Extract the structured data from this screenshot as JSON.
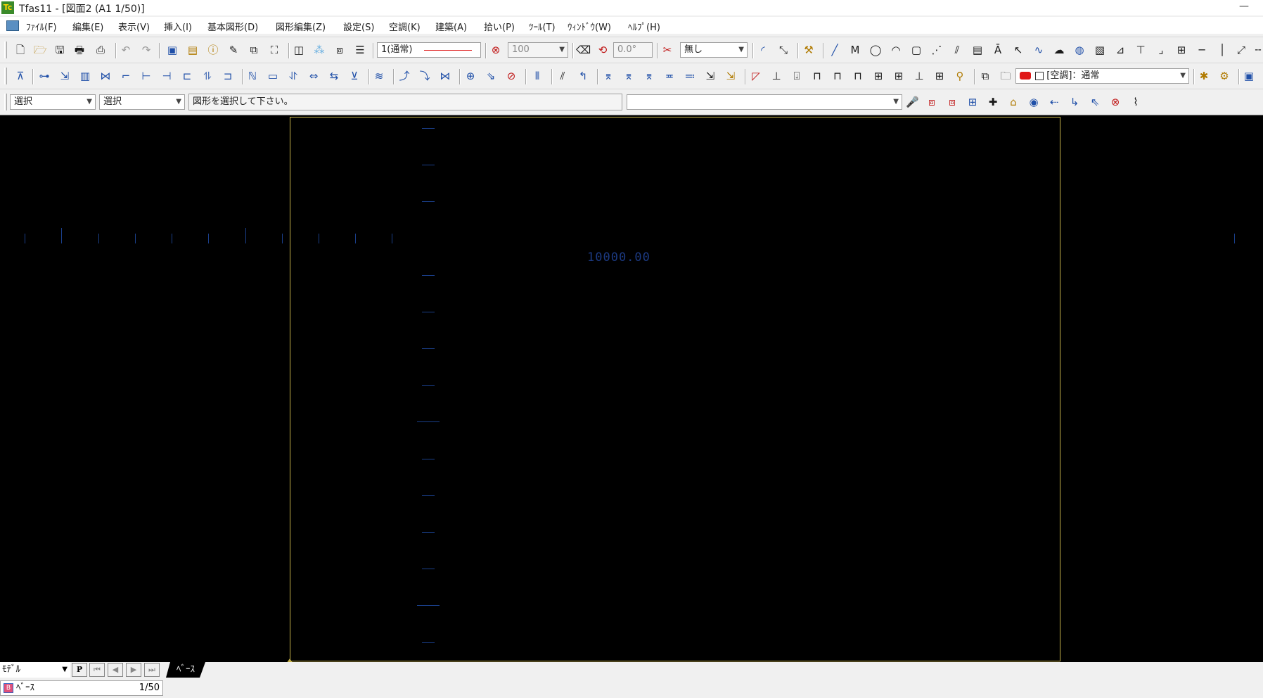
{
  "window": {
    "app_icon": "Tc",
    "title": "Tfas11 - [図面2 (A1 1/50)]",
    "minimize": "—"
  },
  "menu": {
    "items": [
      "ﾌｧｲﾙ(F)",
      "編集(E)",
      "表示(V)",
      "挿入(I)",
      "基本図形(D)",
      "図形編集(Z)",
      "設定(S)",
      "空調(K)",
      "建築(A)",
      "拾い(P)",
      "ﾂｰﾙ(T)",
      "ｳｨﾝﾄﾞｳ(W)",
      "ﾍﾙﾌﾟ(H)"
    ]
  },
  "toolbar1": {
    "line_type": "1(通常)",
    "pen_value": "100",
    "angle": "0.0°",
    "snap_mode": "無し"
  },
  "toolbar2": {
    "mode_select": "[空調]：通常"
  },
  "toolbar3": {
    "select_mode_1": "選択",
    "select_mode_2": "選択",
    "hint": "図形を選択して下さい。",
    "command_input": ""
  },
  "canvas": {
    "dimension_text": "10000.00"
  },
  "bottom": {
    "space_select": "ﾓﾃﾞﾙ",
    "paper_btn": "P",
    "layer_tab": "ﾍﾞｰｽ",
    "layer_badge": "B",
    "layer_name": "ﾍﾞｰｽ",
    "layer_scale": "1/50"
  },
  "colors": {
    "canvas": "#000000",
    "paper_border": "#c8b44a",
    "grid_ticks": "#1a3f8a",
    "linetype_sample": "#e02020"
  }
}
